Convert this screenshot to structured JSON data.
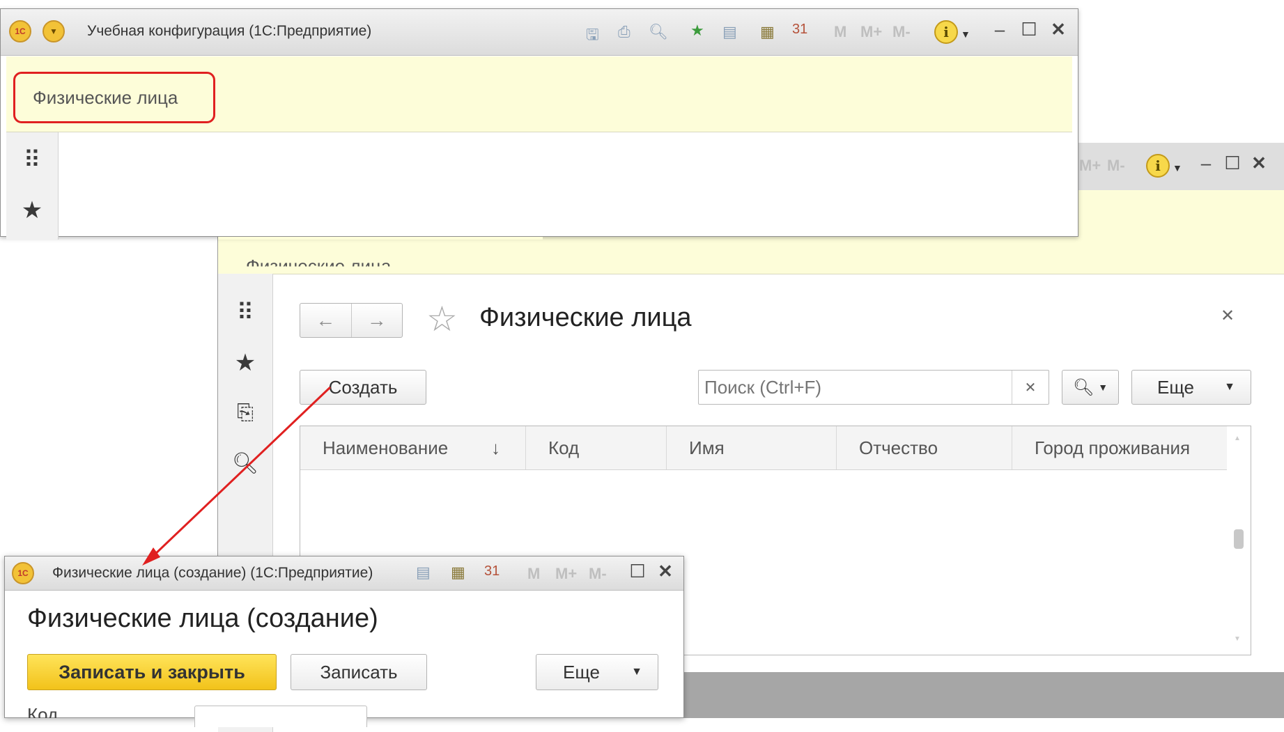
{
  "main_window": {
    "title": "Учебная конфигурация  (1С:Предприятие)",
    "section_button": "Физические лица",
    "m_buttons": [
      "M",
      "M+",
      "M-"
    ]
  },
  "list_window": {
    "section_label_partial": "Физические лица",
    "title": "Физические лица",
    "create_button": "Создать",
    "search_placeholder": "Поиск (Ctrl+F)",
    "more_button": "Еще",
    "columns": [
      "Наименование",
      "Код",
      "Имя",
      "Отчество",
      "Город проживания"
    ],
    "sort_indicator": "↓",
    "m_buttons": [
      "M+",
      "M-"
    ]
  },
  "create_window": {
    "titlebar": "Физические лица (создание)  (1С:Предприятие)",
    "title": "Физические лица (создание)",
    "save_close_button": "Записать и закрыть",
    "save_button": "Записать",
    "more_button": "Еще",
    "field_label_partial": "Код",
    "m_buttons": [
      "M",
      "M+",
      "M-"
    ]
  },
  "logo_text": "1С",
  "colors": {
    "section_bg": "#fdfdd9",
    "highlight_red": "#e02020",
    "accent_yellow": "#f5cc2a"
  }
}
